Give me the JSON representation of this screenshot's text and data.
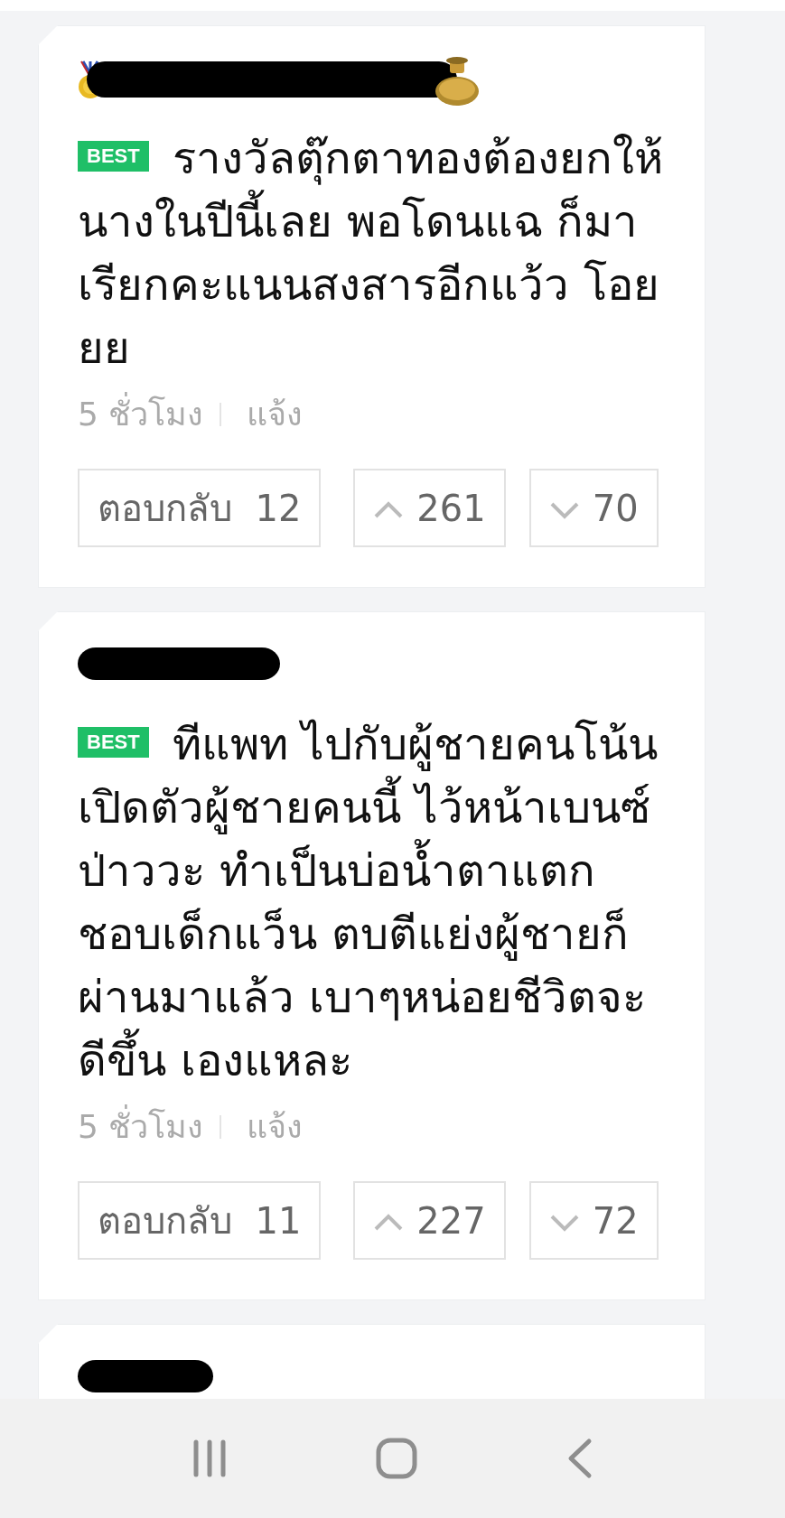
{
  "comments": [
    {
      "author": {
        "redacted": true,
        "decorated": true
      },
      "badge": "BEST",
      "text": "รางวัลตุ๊กตาทองต้องยกให้นางในปีนี้เลย พอโดนแฉ ก็มาเรียกคะแนนสงสารอีกแว้ว โอยยย",
      "time": "5 ชั่วโมง",
      "report": "แจ้ง",
      "reply_label": "ตอบกลับ",
      "reply_count": "12",
      "upvotes": "261",
      "downvotes": "70"
    },
    {
      "author": {
        "redacted": true,
        "decorated": false
      },
      "badge": "BEST",
      "text": "ทีแพท ไปกับผู้ชายคนโน้นเปิดตัวผู้ชายคนนี้ ไว้หน้าเบนซ์ป่าววะ ทำเป็นบ่อน้ำตาแตก ชอบเด็กแว็น ตบตีแย่งผู้ชายก็ผ่านมาแล้ว เบาๆหน่อยชีวิตจะดีขึ้น เองแหละ",
      "time": "5 ชั่วโมง",
      "report": "แจ้ง",
      "reply_label": "ตอบกลับ",
      "reply_count": "11",
      "upvotes": "227",
      "downvotes": "72"
    },
    {
      "author": {
        "redacted": true,
        "decorated": false
      }
    }
  ]
}
